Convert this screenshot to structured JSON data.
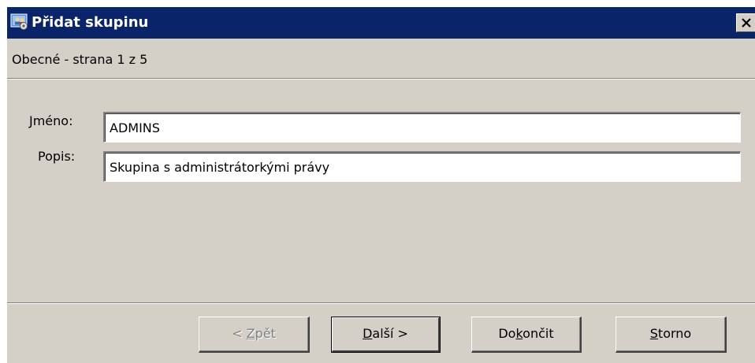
{
  "window": {
    "title": "Přidat skupinu",
    "close_label": "×"
  },
  "wizard": {
    "page_label": "Obecné - strana 1 z 5"
  },
  "form": {
    "name_label": "Jméno:",
    "name_value": "ADMINS",
    "description_label": "Popis:",
    "description_value": "Skupina s administrátorkými právy"
  },
  "buttons": {
    "back": {
      "pre": "< ",
      "mnemonic": "Z",
      "post": "pět",
      "enabled": false
    },
    "next": {
      "pre": "",
      "mnemonic": "D",
      "post": "alší >",
      "enabled": true
    },
    "finish": {
      "pre": "Do",
      "mnemonic": "k",
      "post": "ončit",
      "enabled": true
    },
    "cancel": {
      "pre": "",
      "mnemonic": "S",
      "post": "torno",
      "enabled": true
    }
  },
  "colors": {
    "titlebar": "#0a246a",
    "face": "#d4d0c8",
    "disabled_text": "#808080"
  },
  "icons": {
    "app": "group-users-icon",
    "close": "close-icon"
  }
}
